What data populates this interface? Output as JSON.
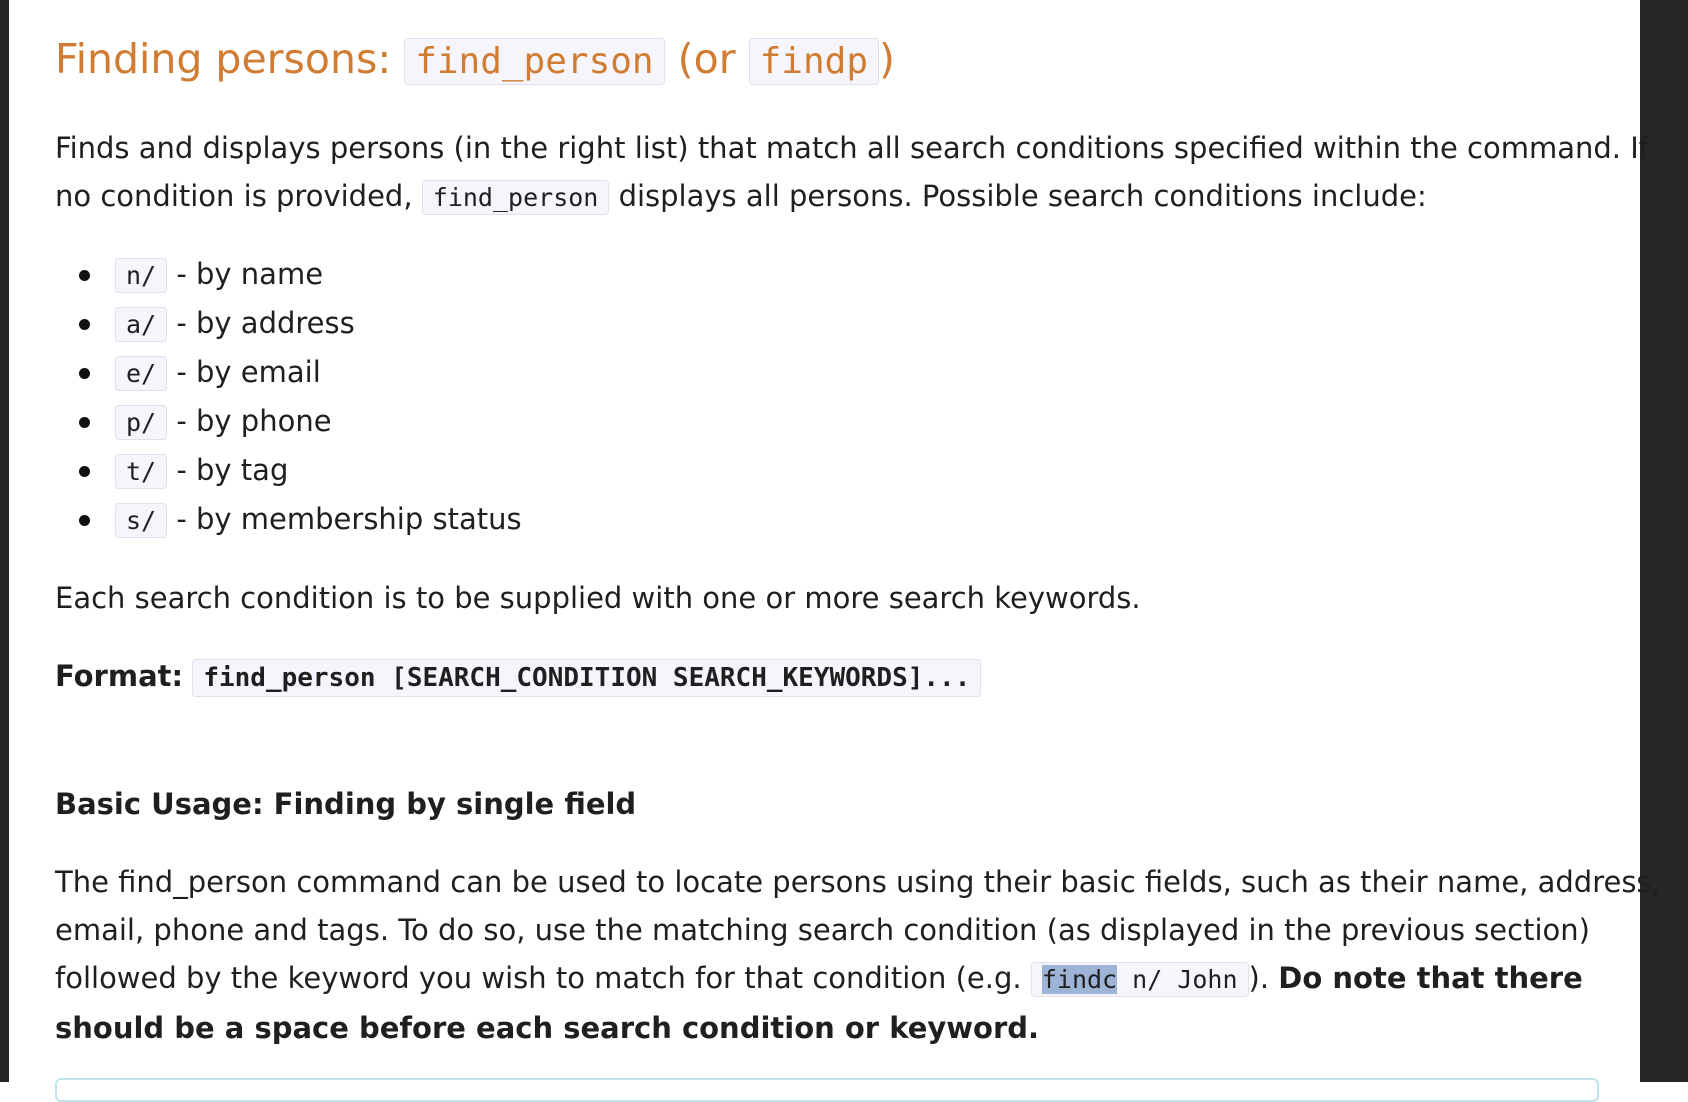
{
  "heading": {
    "prefix": "Finding persons: ",
    "command": "find_person",
    "middle": " (or ",
    "alias": "findp",
    "suffix": ")"
  },
  "intro": {
    "line1": "Finds and displays persons (in the right list) that match all search conditions specified within the command. If",
    "line2_before": "no condition is provided, ",
    "line2_code": "find_person",
    "line2_after": " displays all persons. Possible search conditions include:"
  },
  "conditions": [
    {
      "prefix": "n/",
      "desc": " - by name"
    },
    {
      "prefix": "a/",
      "desc": " - by address"
    },
    {
      "prefix": "e/",
      "desc": " - by email"
    },
    {
      "prefix": "p/",
      "desc": " - by phone"
    },
    {
      "prefix": "t/",
      "desc": " - by tag"
    },
    {
      "prefix": "s/",
      "desc": " - by membership status"
    }
  ],
  "keywords_note": "Each search condition is to be supplied with one or more search keywords.",
  "format": {
    "label": "Format:",
    "code": "find_person [SEARCH_CONDITION SEARCH_KEYWORDS]..."
  },
  "basic_usage": {
    "heading": "Basic Usage: Finding by single field",
    "line1": "The find_person command can be used to locate persons using their basic fields, such as their name, address,",
    "line2": "email, phone and tags. To do so, use the matching search condition (as displayed in the previous section)",
    "line3_before": "followed by the keyword you wish to match for that condition (e.g. ",
    "line3_code_highlight": "findc",
    "line3_code_rest": " n/ John",
    "line3_after": "). ",
    "bold_line3": "Do note that there",
    "bold_line4": "should be a space before each search condition or keyword."
  },
  "colors": {
    "heading": "#d07c32",
    "code_background": "#f5f5fb",
    "selection_highlight": "#9db4d6"
  }
}
